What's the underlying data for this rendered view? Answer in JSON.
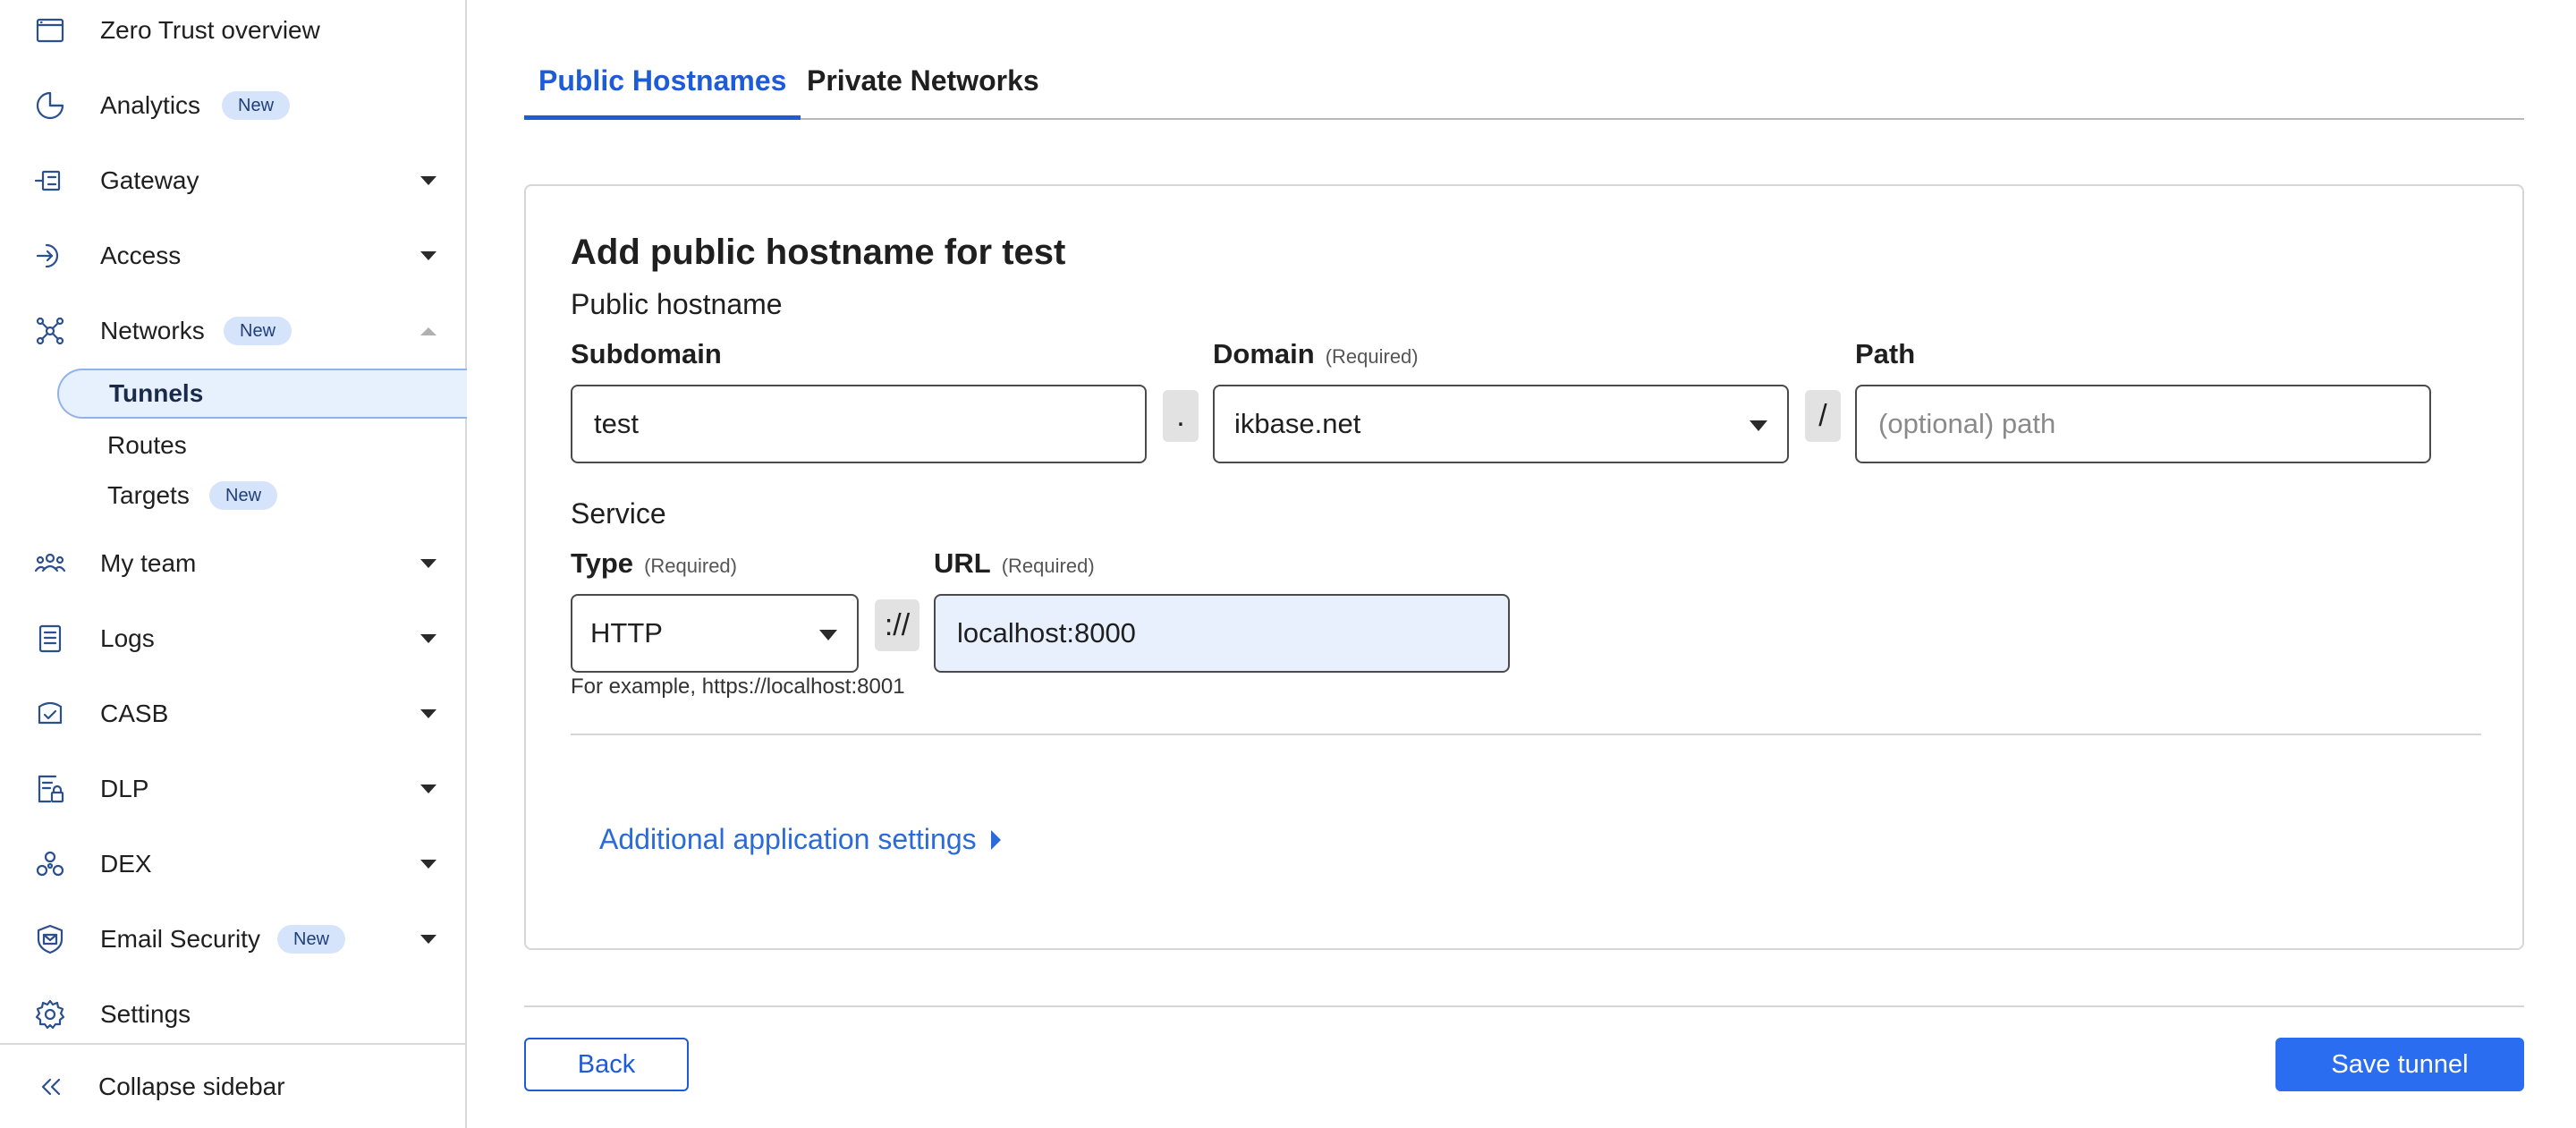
{
  "sidebar": {
    "overview": "Zero Trust overview",
    "analytics": "Analytics",
    "gateway": "Gateway",
    "access": "Access",
    "networks": "Networks",
    "tunnels": "Tunnels",
    "routes": "Routes",
    "targets": "Targets",
    "my_team": "My team",
    "logs": "Logs",
    "casb": "CASB",
    "dlp": "DLP",
    "dex": "DEX",
    "email_security": "Email Security",
    "settings": "Settings",
    "collapse": "Collapse sidebar",
    "badge_new": "New"
  },
  "tabs": {
    "public": "Public Hostnames",
    "private": "Private Networks"
  },
  "form": {
    "title": "Add public hostname for test",
    "public_hostname_label": "Public hostname",
    "subdomain_label": "Subdomain",
    "subdomain_value": "test",
    "dot_sep": ".",
    "domain_label": "Domain",
    "required": "(Required)",
    "domain_value": "ikbase.net",
    "slash_sep": "/",
    "path_label": "Path",
    "path_placeholder": "(optional) path",
    "service_label": "Service",
    "type_label": "Type",
    "type_value": "HTTP",
    "scheme_sep": "://",
    "url_label": "URL",
    "url_value": "localhost:8000",
    "hint": "For example, https://localhost:8001",
    "additional_settings": "Additional application settings"
  },
  "buttons": {
    "back": "Back",
    "save": "Save tunnel"
  },
  "colors": {
    "accent": "#1e5bd6",
    "primary_button": "#2a6df0",
    "badge_bg": "#d6e4fb",
    "icon": "#2c4f8e"
  }
}
